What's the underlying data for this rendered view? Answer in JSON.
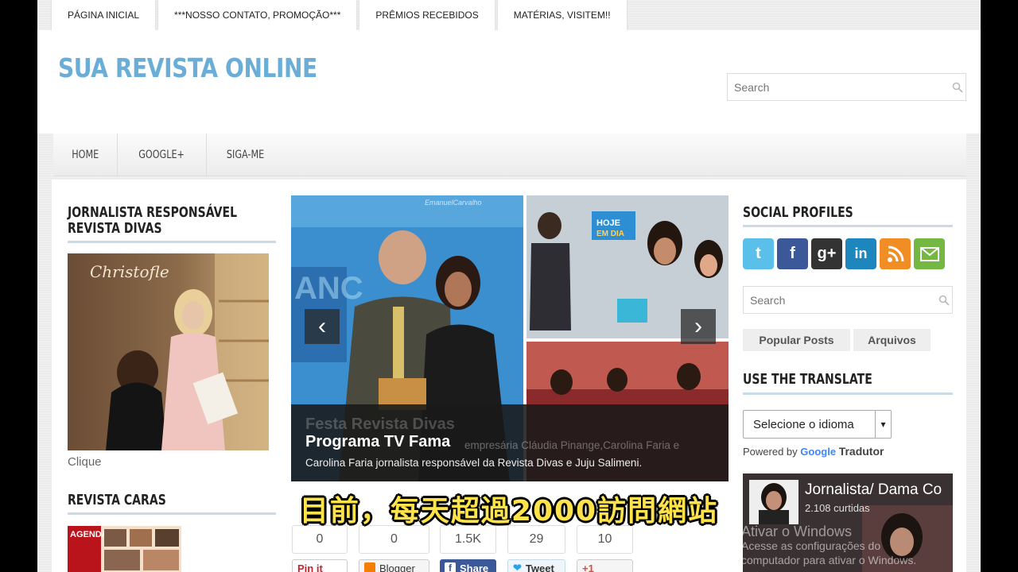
{
  "topnav": [
    "PÁGINA INICIAL",
    "***NOSSO CONTATO, PROMOÇÃO***",
    "PRÊMIOS RECEBIDOS",
    "MATÉRIAS, VISITEM!!"
  ],
  "header": {
    "title": "SUA REVISTA ONLINE",
    "search_placeholder": "Search"
  },
  "mainnav": [
    "HOME",
    "GOOGLE+",
    "SIGA-ME"
  ],
  "left": {
    "widget1_title_line1": "JORNALISTA RESPONSÁVEL",
    "widget1_title_line2": "REVISTA DIVAS",
    "photo_caption": "Clique",
    "widget2_title": "REVISTA CARAS"
  },
  "slider": {
    "ghost_title": "Festa Revista Divas",
    "title": "Programa TV Fama",
    "ghost_text": "empresária Cláudia Pinange,Carolina Faria e",
    "text": "Carolina Faria jornalista responsável da Revista Divas e Juju Salimeni."
  },
  "share": {
    "counts": [
      "0",
      "0",
      "1.5K",
      "29",
      "10"
    ],
    "buttons": [
      "Pin it",
      "Blogger",
      "Share",
      "Tweet",
      "+1"
    ]
  },
  "right": {
    "social_title": "SOCIAL PROFILES",
    "search_placeholder": "Search",
    "tabs": [
      "Popular Posts",
      "Arquivos"
    ],
    "translate_title": "USE THE TRANSLATE",
    "language_select": "Selecione o idioma",
    "powered_by": "Powered by",
    "google": "Google",
    "tradutor": "Tradutor",
    "fb_name": "Jornalista/ Dama Co",
    "fb_likes": "2.108 curtidas"
  },
  "overlay": {
    "subtitle": "目前，每天超過2000訪問網站",
    "win_title": "Ativar o Windows",
    "win_line1": "Acesse as configurações do",
    "win_line2": "computador para ativar o Windows."
  },
  "colors": {
    "title_blue": "#6aaed8",
    "rule_blue": "#c9dbe6",
    "subtitle_yellow": "#ffe34a"
  }
}
